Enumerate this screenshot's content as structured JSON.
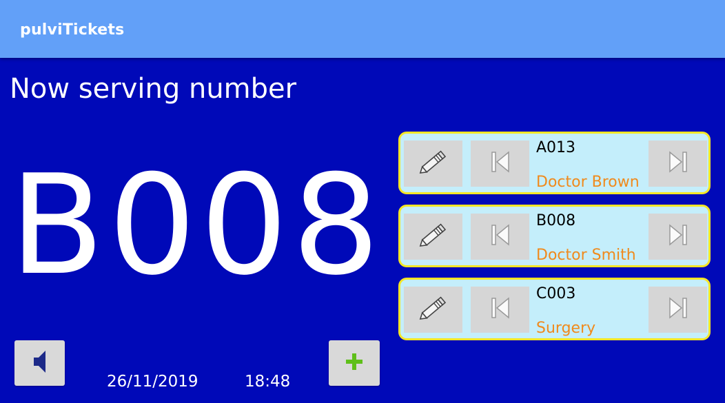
{
  "app": {
    "title": "pulviTickets"
  },
  "main": {
    "heading": "Now serving number",
    "current_number": "B008",
    "date": "26/11/2019",
    "time": "18:48",
    "sound_icon": "speaker-icon",
    "add_icon": "plus-icon"
  },
  "queues": [
    {
      "code": "A013",
      "name": "Doctor Brown"
    },
    {
      "code": "B008",
      "name": "Doctor Smith"
    },
    {
      "code": "C003",
      "name": "Surgery"
    }
  ],
  "colors": {
    "background": "#0009b8",
    "appbar": "#62a0f8",
    "card_bg": "#c4eefb",
    "card_border": "#f5e626",
    "name_text": "#f08a1c",
    "plus": "#5fbf1a"
  }
}
